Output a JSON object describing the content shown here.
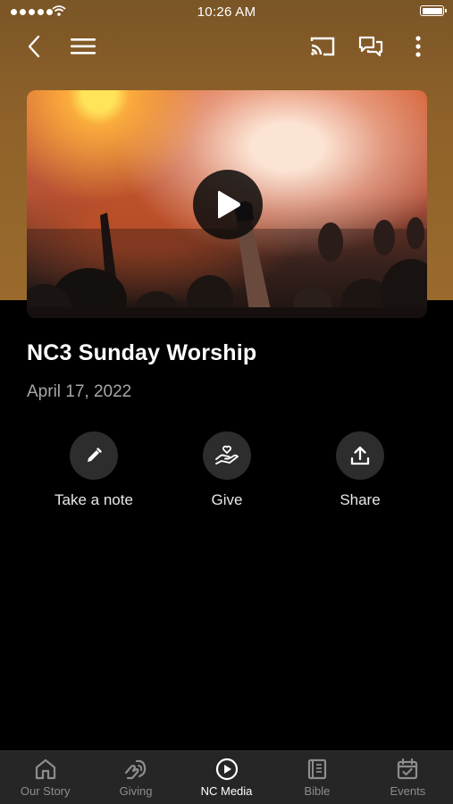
{
  "status_bar": {
    "time": "10:26 AM"
  },
  "nav": {
    "back_icon": "chevron-left-icon",
    "menu_icon": "hamburger-menu-icon",
    "cast_icon": "cast-icon",
    "chat_icon": "chat-bubbles-icon",
    "more_icon": "more-vertical-icon"
  },
  "media": {
    "title": "NC3 Sunday Worship",
    "date": "April 17, 2022",
    "play_icon": "play-icon"
  },
  "actions": [
    {
      "label": "Take a note",
      "icon": "pencil-icon"
    },
    {
      "label": "Give",
      "icon": "heart-hand-icon"
    },
    {
      "label": "Share",
      "icon": "share-upload-icon"
    }
  ],
  "tabs": [
    {
      "label": "Our Story",
      "icon": "home-icon",
      "active": false
    },
    {
      "label": "Giving",
      "icon": "giving-icon",
      "active": false
    },
    {
      "label": "NC Media",
      "icon": "play-circle-icon",
      "active": true
    },
    {
      "label": "Bible",
      "icon": "book-icon",
      "active": false
    },
    {
      "label": "Events",
      "icon": "calendar-check-icon",
      "active": false
    }
  ],
  "colors": {
    "header_brown": "#8f622a",
    "background": "#000000",
    "tabbar": "#262626",
    "inactive_tab": "#8d8d8d"
  }
}
